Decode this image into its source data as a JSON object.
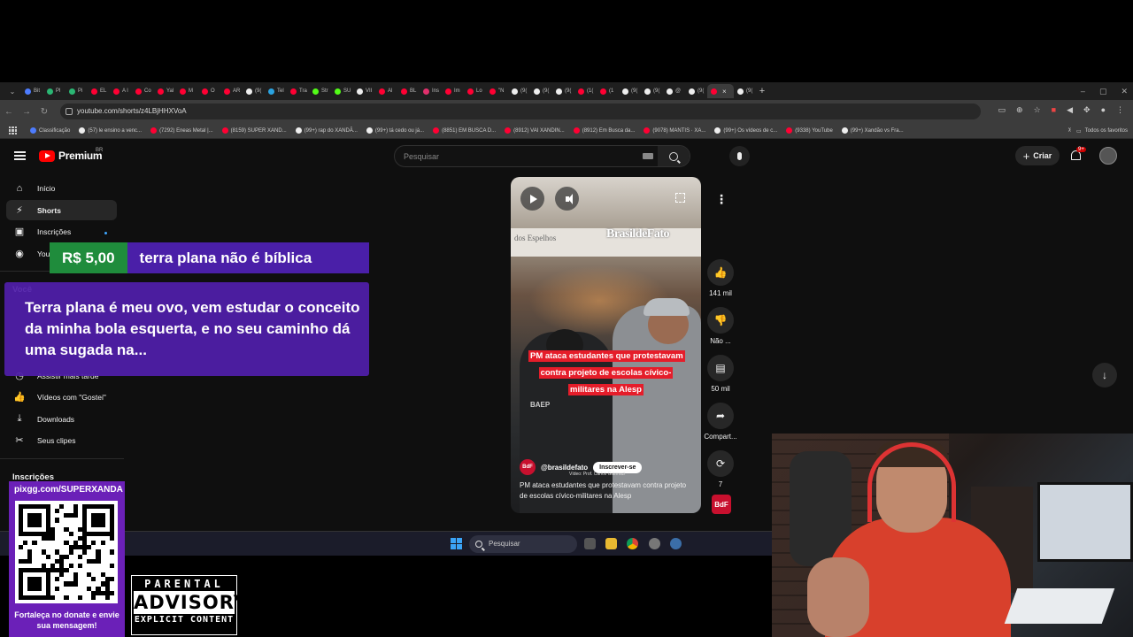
{
  "browser": {
    "tabs": [
      {
        "label": "Bit",
        "color": "#4d7cfe"
      },
      {
        "label": "Pl",
        "color": "#2bb673"
      },
      {
        "label": "Pi",
        "color": "#2bb673"
      },
      {
        "label": "EL",
        "color": "#ff0033"
      },
      {
        "label": "A l",
        "color": "#ff0033"
      },
      {
        "label": "Co",
        "color": "#ff0033"
      },
      {
        "label": "Yal",
        "color": "#ff0033"
      },
      {
        "label": "M",
        "color": "#ff0033"
      },
      {
        "label": "O",
        "color": "#ff0033"
      },
      {
        "label": "AR",
        "color": "#ff0033"
      },
      {
        "label": "(9(",
        "color": "#eeeeee"
      },
      {
        "label": "Tel",
        "color": "#2aa3e0"
      },
      {
        "label": "Tra",
        "color": "#ff0033"
      },
      {
        "label": "Str",
        "color": "#53fc18"
      },
      {
        "label": "SU",
        "color": "#53fc18"
      },
      {
        "label": "VII",
        "color": "#eeeeee"
      },
      {
        "label": "Al",
        "color": "#ff0033"
      },
      {
        "label": "BL",
        "color": "#ff0033"
      },
      {
        "label": "Ins",
        "color": "#e1306c"
      },
      {
        "label": "Im",
        "color": "#ff0033"
      },
      {
        "label": "Lo",
        "color": "#ff0033"
      },
      {
        "label": "\"N",
        "color": "#ff0033"
      },
      {
        "label": "(9(",
        "color": "#eeeeee"
      },
      {
        "label": "(9(",
        "color": "#eeeeee"
      },
      {
        "label": "(9(",
        "color": "#eeeeee"
      },
      {
        "label": "(1(",
        "color": "#ff0033"
      },
      {
        "label": "(1",
        "color": "#ff0033"
      },
      {
        "label": "(9(",
        "color": "#eeeeee"
      },
      {
        "label": "(9(",
        "color": "#eeeeee"
      },
      {
        "label": "@",
        "color": "#eeeeee"
      },
      {
        "label": "(9(",
        "color": "#eeeeee"
      },
      {
        "label": "",
        "color": "#ff0033",
        "active": true
      },
      {
        "label": "(9(",
        "color": "#eeeeee"
      }
    ],
    "url": "youtube.com/shorts/z4LBjHHXVoA",
    "bookmarks": [
      {
        "label": "Classificação",
        "color": "#4d7cfe"
      },
      {
        "label": "(57) le ensino a venc...",
        "color": "#eeeeee"
      },
      {
        "label": "(7292) Eneas Metal |...",
        "color": "#ff0033"
      },
      {
        "label": "(8159) SUPER XAND...",
        "color": "#ff0033"
      },
      {
        "label": "(99+) rap do XANDÃ...",
        "color": "#eeeeee"
      },
      {
        "label": "(99+) tá cedo ou já...",
        "color": "#eeeeee"
      },
      {
        "label": "(8851) EM BUSCA D...",
        "color": "#ff0033"
      },
      {
        "label": "(8912) VAI XANDIN...",
        "color": "#ff0033"
      },
      {
        "label": "(8912) Em Busca da...",
        "color": "#ff0033"
      },
      {
        "label": "(9078) MANTIS · XA...",
        "color": "#ff0033"
      },
      {
        "label": "(99+) Os vídeos de c...",
        "color": "#eeeeee"
      },
      {
        "label": "(9338) YouTube",
        "color": "#ff0033"
      },
      {
        "label": "(99+) Xandão vs Fra...",
        "color": "#eeeeee"
      }
    ],
    "favorites_label": "Todos os favoritos"
  },
  "youtube": {
    "logo_text": "Premium",
    "country": "BR",
    "search_placeholder": "Pesquisar",
    "create_label": "Criar",
    "notif_badge": "9+",
    "sidebar": {
      "items": [
        {
          "label": "Início",
          "icon": "home-icon",
          "glyph": "⌂"
        },
        {
          "label": "Shorts",
          "icon": "shorts-icon",
          "glyph": "⚡",
          "active": true
        },
        {
          "label": "Inscrições",
          "icon": "subscriptions-icon",
          "glyph": "▣"
        },
        {
          "label": "YouTube",
          "icon": "youtube-music-icon",
          "glyph": "◉"
        }
      ],
      "you_header": "Você",
      "you_items": [
        {
          "label": "Assistir mais tarde",
          "icon": "clock-icon",
          "glyph": "◷"
        },
        {
          "label": "Vídeos com \"Gostei\"",
          "icon": "thumb-up-icon",
          "glyph": "👍"
        },
        {
          "label": "Downloads",
          "icon": "download-icon",
          "glyph": "⤓"
        },
        {
          "label": "Seus clipes",
          "icon": "scissors-icon",
          "glyph": "✂"
        }
      ],
      "subs_header": "Inscrições"
    },
    "short": {
      "wall_text": "dos Espelhos",
      "brand_watermark": "BrasildeFato",
      "vest_text": "BAEP",
      "caption": "PM ataca estudantes que protestavam contra projeto de escolas cívico-militares na Alesp",
      "channel_avatar": "BdF",
      "channel": "@brasildefato",
      "subscribe_label": "Inscrever-se",
      "credit": "Vídeo: Prof. Carlos Giannazi",
      "description": "PM ataca estudantes que protestavam contra projeto de escolas cívico-militares na Alesp"
    },
    "actions": {
      "likes": "141 mil",
      "dislike": "Não ...",
      "comments": "50 mil",
      "share": "Compart...",
      "remix": "7",
      "bdf_label": "BdF"
    }
  },
  "taskbar": {
    "search_placeholder": "Pesquisar"
  },
  "overlays": {
    "donation": {
      "amount": "R$ 5,00",
      "title": "terra plana não é bíblica",
      "message": "Terra plana é meu ovo, vem estudar o conceito da minha bola esquerta, e no seu caminho dá uma sugada na..."
    },
    "pix": {
      "url": "pixgg.com/SUPERXANDA",
      "caption": "Fortaleça no donate e envie sua mensagem!"
    },
    "parental_advisory": {
      "top": "PARENTAL",
      "middle": "ADVISORY",
      "bottom": "EXPLICIT CONTENT"
    }
  }
}
